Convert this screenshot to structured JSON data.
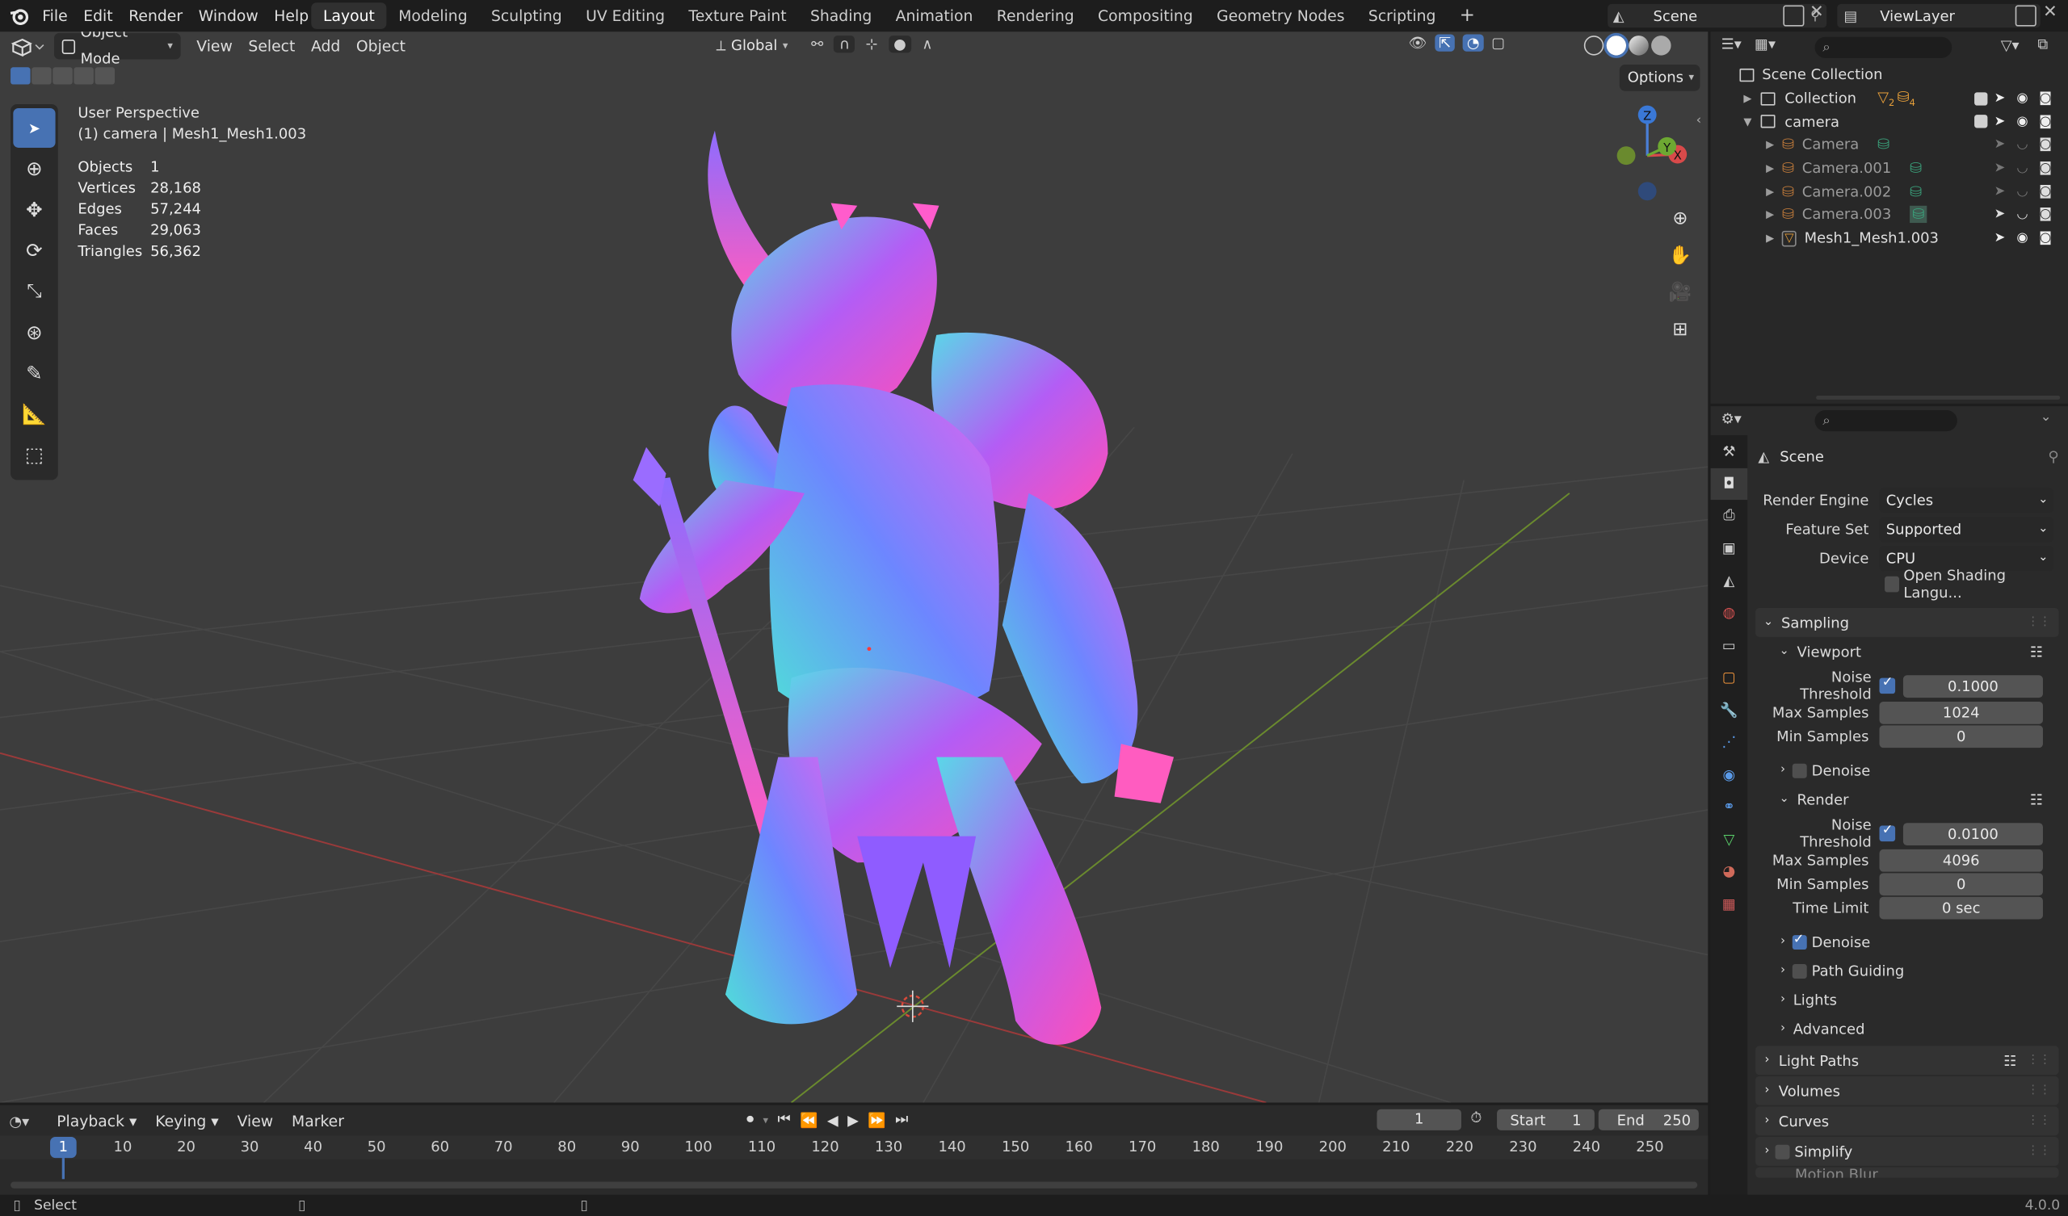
{
  "topbar": {
    "menus": [
      "File",
      "Edit",
      "Render",
      "Window",
      "Help"
    ],
    "workspaces": [
      "Layout",
      "Modeling",
      "Sculpting",
      "UV Editing",
      "Texture Paint",
      "Shading",
      "Animation",
      "Rendering",
      "Compositing",
      "Geometry Nodes",
      "Scripting"
    ],
    "active_workspace": "Layout",
    "scene": "Scene",
    "view_layer": "ViewLayer"
  },
  "viewport_header": {
    "mode": "Object Mode",
    "menus": [
      "View",
      "Select",
      "Add",
      "Object"
    ],
    "orientation": "Global",
    "options": "Options"
  },
  "overlay": {
    "view_name": "User Perspective",
    "object_line": "(1) camera | Mesh1_Mesh1.003",
    "stats": [
      {
        "label": "Objects",
        "value": "1"
      },
      {
        "label": "Vertices",
        "value": "28,168"
      },
      {
        "label": "Edges",
        "value": "57,244"
      },
      {
        "label": "Faces",
        "value": "29,063"
      },
      {
        "label": "Triangles",
        "value": "56,362"
      }
    ]
  },
  "gizmo": {
    "z": "Z",
    "y": "Y",
    "x": "X"
  },
  "outliner": {
    "root": "Scene Collection",
    "rows": [
      {
        "label": "Collection",
        "dim": false
      },
      {
        "label": "camera",
        "dim": false
      },
      {
        "label": "Camera",
        "dim": true
      },
      {
        "label": "Camera.001",
        "dim": true
      },
      {
        "label": "Camera.002",
        "dim": true
      },
      {
        "label": "Camera.003",
        "dim": true
      },
      {
        "label": "Mesh1_Mesh1.003",
        "dim": false
      }
    ],
    "collection_badges": [
      "2",
      "4"
    ]
  },
  "properties": {
    "context": "Scene",
    "render_engine_label": "Render Engine",
    "render_engine": "Cycles",
    "feature_set_label": "Feature Set",
    "feature_set": "Supported",
    "device_label": "Device",
    "device": "CPU",
    "osl_label": "Open Shading Langu...",
    "sampling": "Sampling",
    "viewport": "Viewport",
    "render": "Render",
    "noise_threshold_label": "Noise Threshold",
    "max_samples_label": "Max Samples",
    "min_samples_label": "Min Samples",
    "time_limit_label": "Time Limit",
    "vp_noise_threshold": "0.1000",
    "vp_max_samples": "1024",
    "vp_min_samples": "0",
    "r_noise_threshold": "0.0100",
    "r_max_samples": "4096",
    "r_min_samples": "0",
    "r_time_limit": "0 sec",
    "denoise": "Denoise",
    "path_guiding": "Path Guiding",
    "lights": "Lights",
    "advanced": "Advanced",
    "light_paths": "Light Paths",
    "volumes": "Volumes",
    "curves": "Curves",
    "simplify": "Simplify",
    "motion_blur": "Motion Blur"
  },
  "timeline": {
    "menus": [
      "Playback",
      "Keying",
      "View",
      "Marker"
    ],
    "current_frame": "1",
    "start_label": "Start",
    "start": "1",
    "end_label": "End",
    "end": "250",
    "ticks": [
      "1",
      "10",
      "20",
      "30",
      "40",
      "50",
      "60",
      "70",
      "80",
      "90",
      "100",
      "110",
      "120",
      "130",
      "140",
      "150",
      "160",
      "170",
      "180",
      "190",
      "200",
      "210",
      "220",
      "230",
      "240",
      "250"
    ]
  },
  "statusbar": {
    "action": "Select",
    "version": "4.0.0"
  },
  "colors": {
    "accent": "#4772b3",
    "background": "#3d3d3d",
    "panel": "#2a2a2a"
  }
}
